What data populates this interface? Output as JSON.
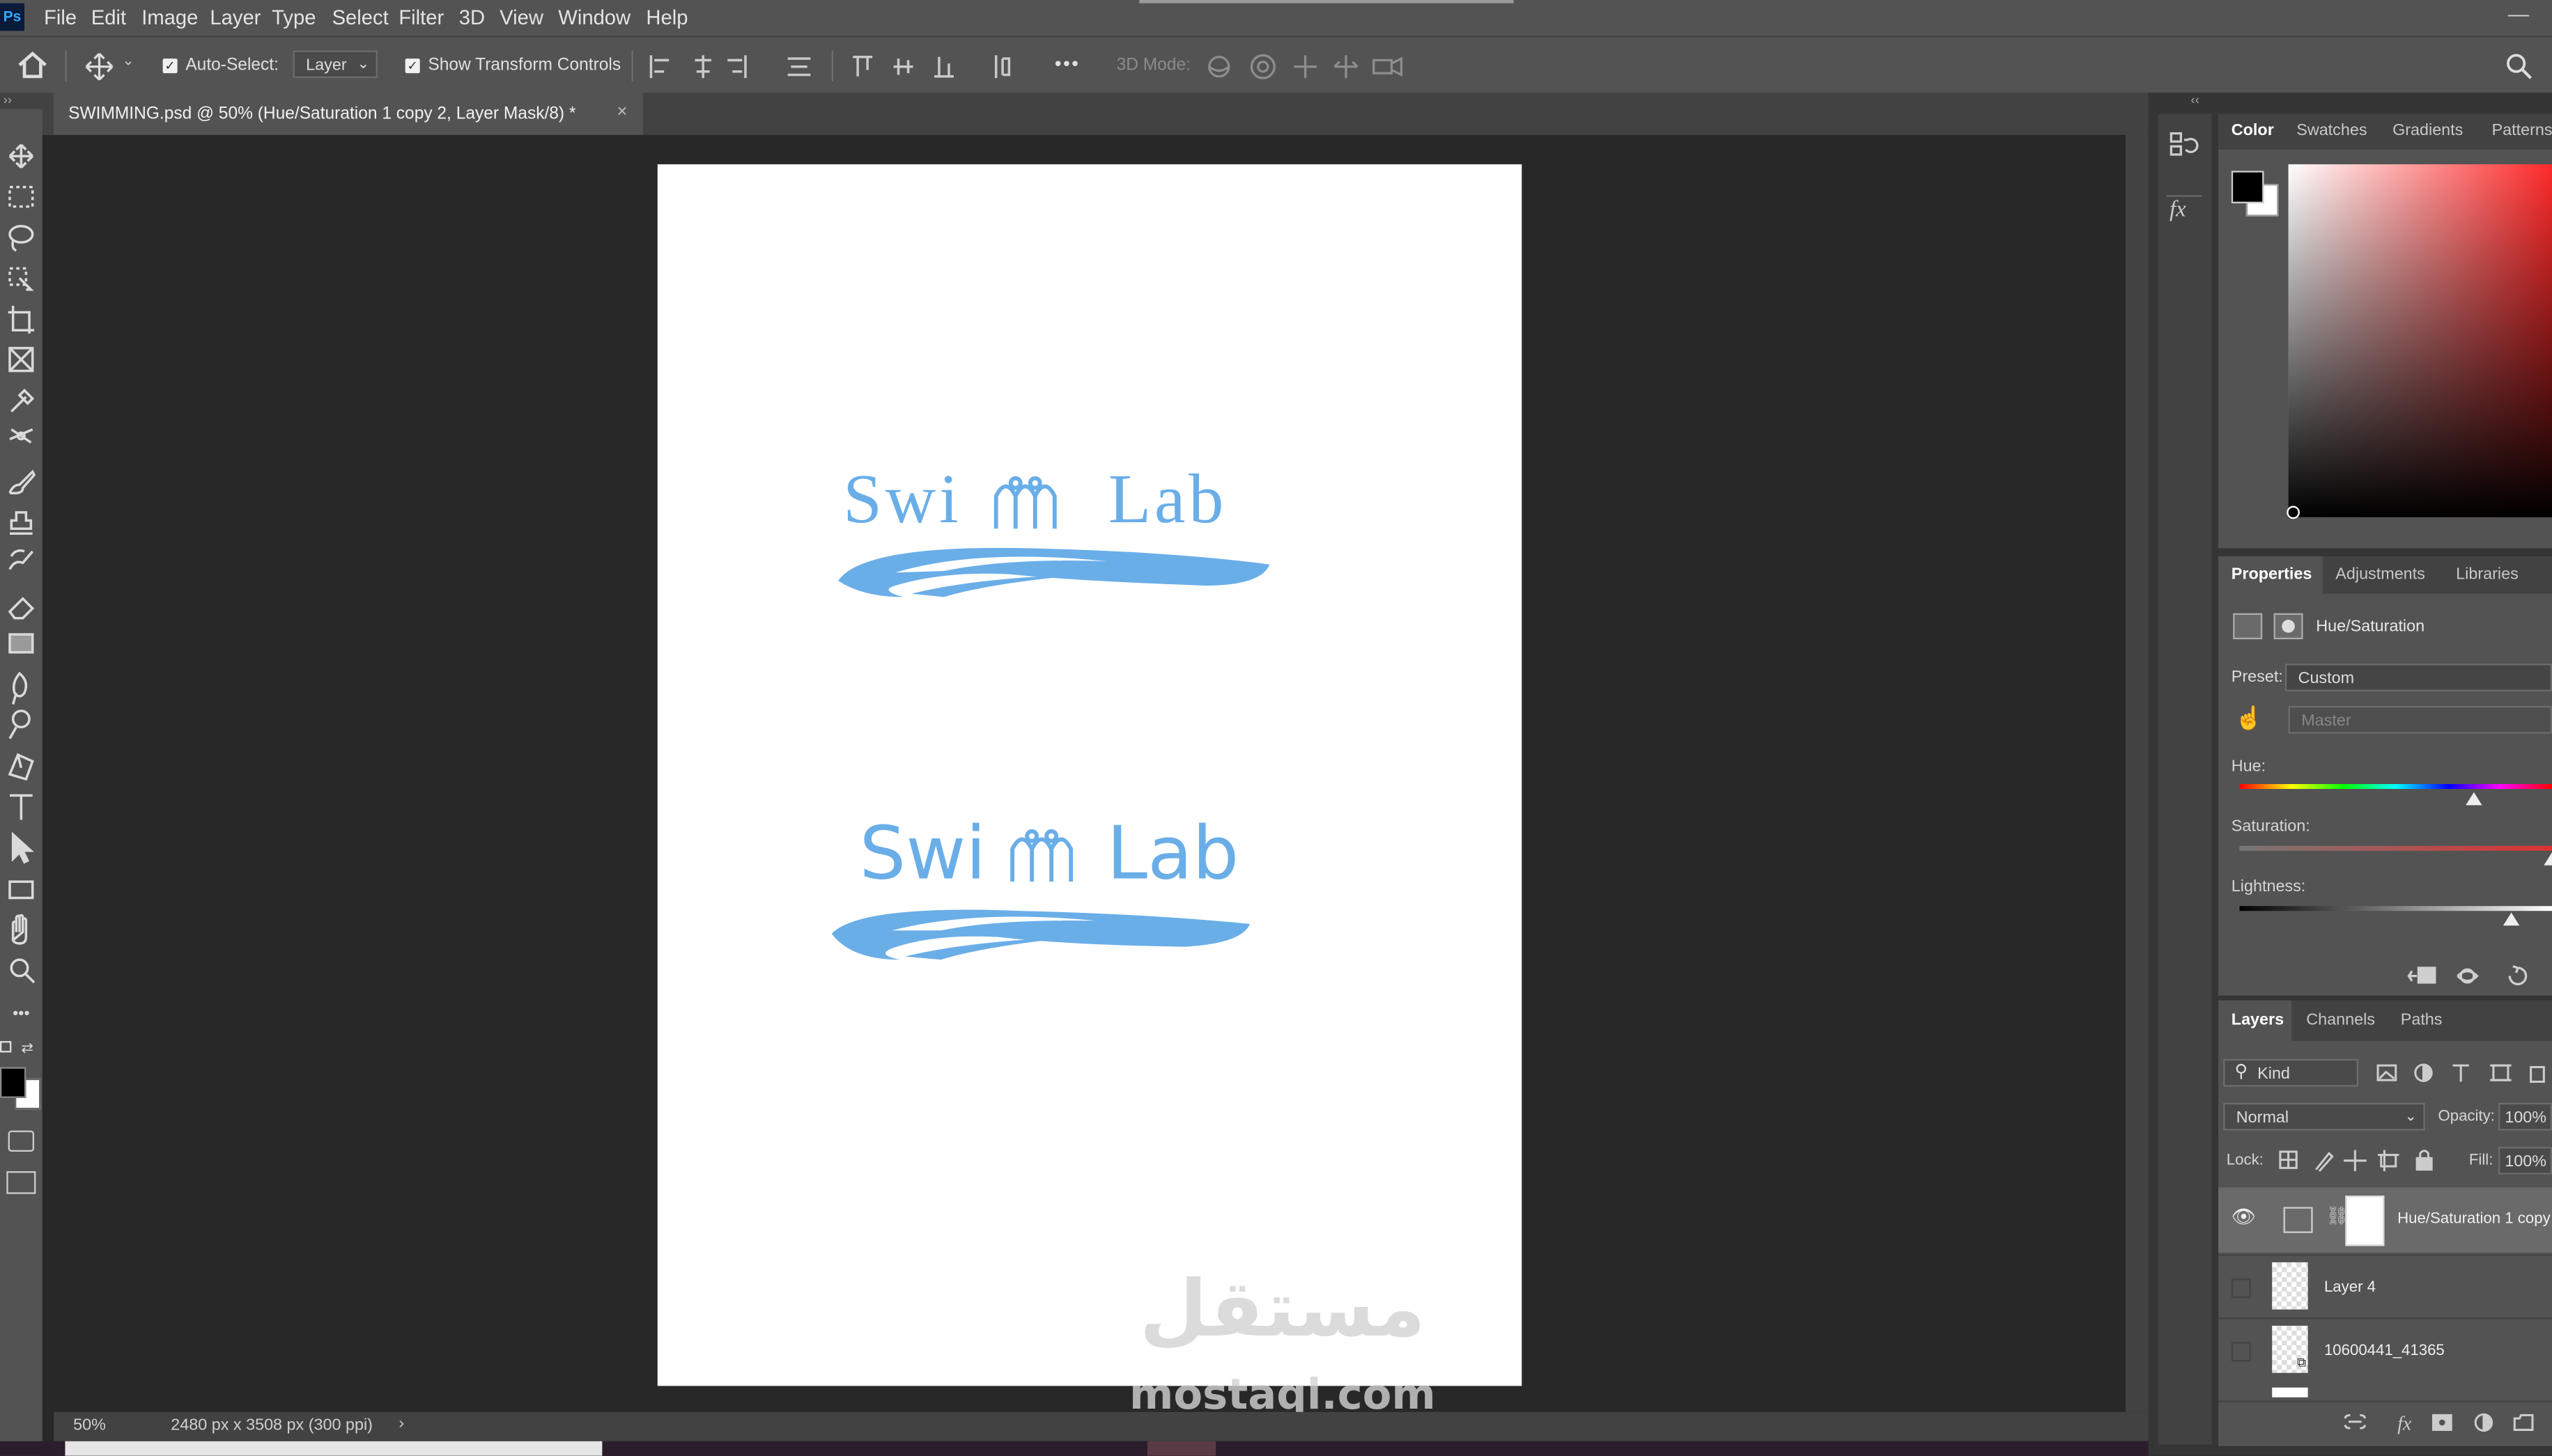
{
  "app": {
    "badge": "Ps"
  },
  "menu": [
    "File",
    "Edit",
    "Image",
    "Layer",
    "Type",
    "Select",
    "Filter",
    "3D",
    "View",
    "Window",
    "Help"
  ],
  "window_controls": {
    "minimize": "—"
  },
  "options": {
    "auto_select_label": "Auto-Select:",
    "auto_select_checked": true,
    "auto_select_target": "Layer",
    "show_transform_label": "Show Transform Controls",
    "show_transform_checked": true,
    "mode_3d_label": "3D Mode:",
    "more": "•••"
  },
  "document_tab": {
    "title": "SWIMMING.psd @ 50% (Hue/Saturation 1 copy 2, Layer Mask/8) *",
    "close": "×"
  },
  "canvas": {
    "logos": [
      {
        "part1": "Swi",
        "part2": "Lab",
        "style": "serif"
      },
      {
        "part1": "Swi",
        "part2": "Lab",
        "style": "sans"
      }
    ],
    "watermark": {
      "arabic": "مستقل",
      "latin": "mostaql.com"
    }
  },
  "status": {
    "zoom": "50%",
    "doc_info": "2480 px x 3508 px (300 ppi)",
    "arrow": "›"
  },
  "color_panel": {
    "tabs": [
      "Color",
      "Swatches",
      "Gradients",
      "Patterns"
    ],
    "active": "Color",
    "foreground": "#000000",
    "background": "#ffffff",
    "hue_color": "#ff2a2a"
  },
  "properties_panel": {
    "tabs": [
      "Properties",
      "Adjustments",
      "Libraries"
    ],
    "active": "Properties",
    "title": "Hue/Saturation",
    "preset_label": "Preset:",
    "preset_value": "Custom",
    "channel_value": "Master",
    "hue_label": "Hue:",
    "hue": 0.75,
    "saturation_label": "Saturation:",
    "saturation": 1.0,
    "lightness_label": "Lightness:",
    "lightness": 0.87
  },
  "layers_panel": {
    "tabs": [
      "Layers",
      "Channels",
      "Paths"
    ],
    "active": "Layers",
    "filter_kind": "Kind",
    "blend_mode": "Normal",
    "opacity_label": "Opacity:",
    "opacity_value": "100%",
    "lock_label": "Lock:",
    "fill_label": "Fill:",
    "fill_value": "100%",
    "layers": [
      {
        "name": "Hue/Saturation 1 copy",
        "visible": true
      },
      {
        "name": "Layer 4",
        "visible": false
      },
      {
        "name": "10600441_41365",
        "visible": false
      }
    ]
  },
  "colors": {
    "logo_blue": "#6aaee8",
    "ui_panel": "#535353",
    "ui_dark": "#282828"
  }
}
